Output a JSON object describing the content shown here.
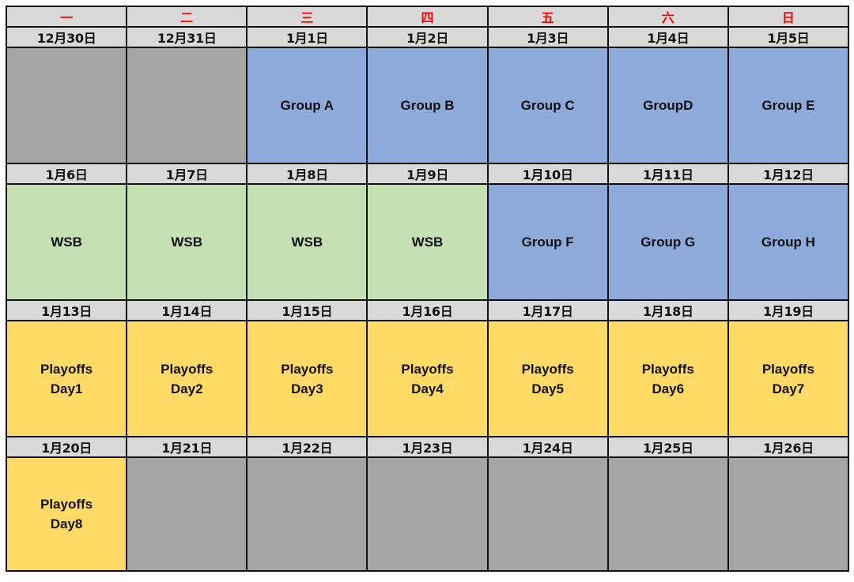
{
  "colors": {
    "header_bg": "#d9d9d9",
    "weekday_text": "#ff0000",
    "empty": "#a5a5a5",
    "group": "#8eaadb",
    "wsb": "#c5e0b3",
    "playoffs": "#ffd966",
    "border": "#111111"
  },
  "weekdays": [
    "一",
    "二",
    "三",
    "四",
    "五",
    "六",
    "日"
  ],
  "weeks": [
    {
      "dates": [
        "12月30日",
        "12月31日",
        "1月1日",
        "1月2日",
        "1月3日",
        "1月4日",
        "1月5日"
      ],
      "cells": [
        {
          "type": "empty",
          "label": ""
        },
        {
          "type": "empty",
          "label": ""
        },
        {
          "type": "group",
          "label": "Group A"
        },
        {
          "type": "group",
          "label": "Group B"
        },
        {
          "type": "group",
          "label": "Group C"
        },
        {
          "type": "group",
          "label": "GroupD"
        },
        {
          "type": "group",
          "label": "Group E"
        }
      ]
    },
    {
      "dates": [
        "1月6日",
        "1月7日",
        "1月8日",
        "1月9日",
        "1月10日",
        "1月11日",
        "1月12日"
      ],
      "cells": [
        {
          "type": "wsb",
          "label": "WSB"
        },
        {
          "type": "wsb",
          "label": "WSB"
        },
        {
          "type": "wsb",
          "label": "WSB"
        },
        {
          "type": "wsb",
          "label": "WSB"
        },
        {
          "type": "group",
          "label": "Group F"
        },
        {
          "type": "group",
          "label": "Group G"
        },
        {
          "type": "group",
          "label": "Group H"
        }
      ]
    },
    {
      "dates": [
        "1月13日",
        "1月14日",
        "1月15日",
        "1月16日",
        "1月17日",
        "1月18日",
        "1月19日"
      ],
      "cells": [
        {
          "type": "playoff",
          "label": "Playoffs\nDay1"
        },
        {
          "type": "playoff",
          "label": "Playoffs\nDay2"
        },
        {
          "type": "playoff",
          "label": "Playoffs\nDay3"
        },
        {
          "type": "playoff",
          "label": "Playoffs\nDay4"
        },
        {
          "type": "playoff",
          "label": "Playoffs\nDay5"
        },
        {
          "type": "playoff",
          "label": "Playoffs\nDay6"
        },
        {
          "type": "playoff",
          "label": "Playoffs\nDay7"
        }
      ]
    },
    {
      "dates": [
        "1月20日",
        "1月21日",
        "1月22日",
        "1月23日",
        "1月24日",
        "1月25日",
        "1月26日"
      ],
      "cells": [
        {
          "type": "playoff",
          "label": "Playoffs\nDay8"
        },
        {
          "type": "empty",
          "label": ""
        },
        {
          "type": "empty",
          "label": ""
        },
        {
          "type": "empty",
          "label": ""
        },
        {
          "type": "empty",
          "label": ""
        },
        {
          "type": "empty",
          "label": ""
        },
        {
          "type": "empty",
          "label": ""
        }
      ]
    }
  ]
}
